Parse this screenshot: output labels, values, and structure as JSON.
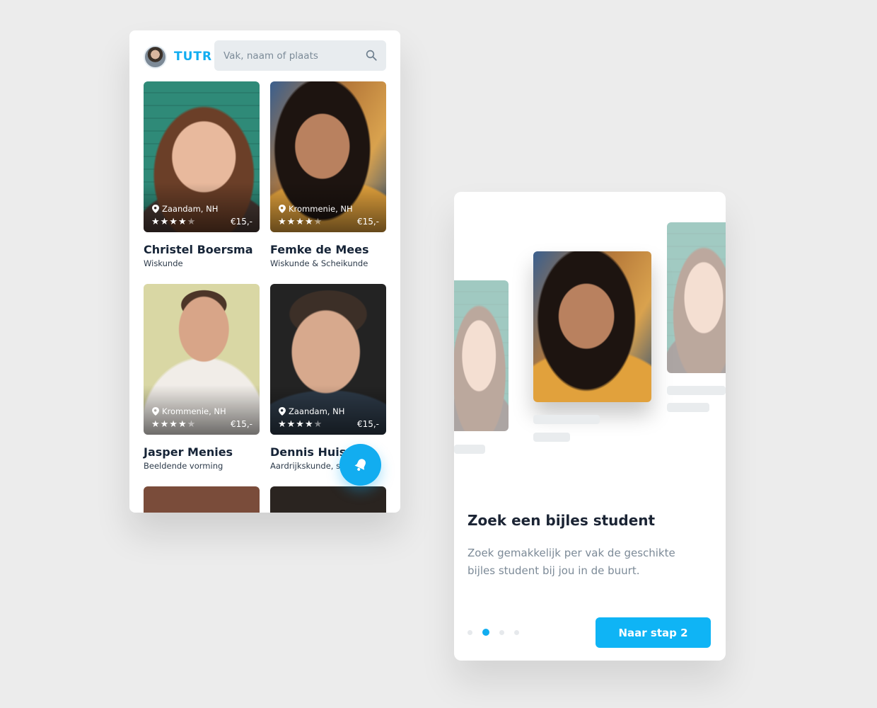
{
  "app": {
    "brand": "TUTR",
    "search": {
      "placeholder": "Vak, naam of plaats"
    },
    "tutors": [
      {
        "name": "Christel Boersma",
        "subject": "Wiskunde",
        "location": "Zaandam, NH",
        "price": "€15,-",
        "rating": 4
      },
      {
        "name": "Femke de Mees",
        "subject": "Wiskunde & Scheikunde",
        "location": "Krommenie, NH",
        "price": "€15,-",
        "rating": 4
      },
      {
        "name": "Jasper Menies",
        "subject": "Beeldende vorming",
        "location": "Krommenie, NH",
        "price": "€15,-",
        "rating": 4
      },
      {
        "name": "Dennis Huism",
        "subject": "Aardrijkskunde, s",
        "location": "Zaandam, NH",
        "price": "€15,-",
        "rating": 4
      }
    ],
    "fab_icon": "bell-icon"
  },
  "onboarding": {
    "title": "Zoek een bijles student",
    "description": "Zoek gemakkelijk per vak de geschikte bijles student bij jou in de buurt.",
    "button": "Naar stap 2",
    "steps_total": 4,
    "active_step": 2
  },
  "colors": {
    "accent": "#12adf0",
    "text_dark": "#162437",
    "text_muted": "#7c8a97",
    "background": "#ececec"
  }
}
